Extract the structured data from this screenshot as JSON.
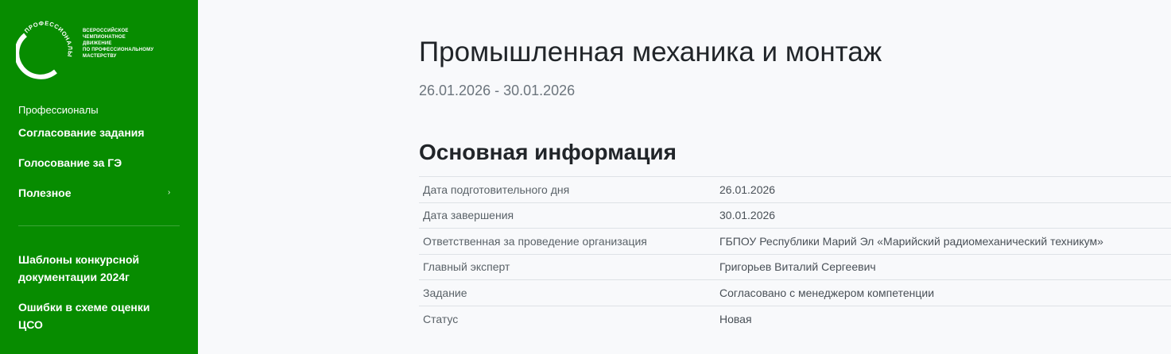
{
  "sidebar": {
    "logo": {
      "arc_text": "ПРОФЕССИОНАЛЫ",
      "lines": [
        "ВСЕРОССИЙСКОЕ",
        "ЧЕМПИОНАТНОЕ",
        "ДВИЖЕНИЕ",
        "ПО ПРОФЕССИОНАЛЬНОМУ",
        "МАСТЕРСТВУ"
      ]
    },
    "section_label": "Профессионалы",
    "items": [
      {
        "label": "Согласование задания"
      },
      {
        "label": "Голосование за ГЭ"
      },
      {
        "label": "Полезное",
        "arrow": "›"
      }
    ],
    "links": [
      {
        "label": "Шаблоны конкурсной документации 2024г"
      },
      {
        "label": "Ошибки в схеме оценки ЦСО"
      }
    ]
  },
  "main": {
    "title": "Промышленная механика и монтаж",
    "date_range": "26.01.2026 - 30.01.2026",
    "section_title": "Основная информация",
    "rows": [
      {
        "label": "Дата подготовительного дня",
        "value": "26.01.2026"
      },
      {
        "label": "Дата завершения",
        "value": "30.01.2026"
      },
      {
        "label": "Ответственная за проведение организация",
        "value": "ГБПОУ Республики Марий Эл «Марийский радиомеханический техникум»"
      },
      {
        "label": "Главный эксперт",
        "value": "Григорьев Виталий Сергеевич"
      },
      {
        "label": "Задание",
        "value": "Согласовано с менеджером компетенции"
      },
      {
        "label": "Статус",
        "value": "Новая"
      }
    ]
  },
  "colors": {
    "sidebar_bg": "#078c00",
    "page_bg": "#f8f9fb",
    "text_primary": "#212529",
    "text_muted": "#6c757d"
  }
}
